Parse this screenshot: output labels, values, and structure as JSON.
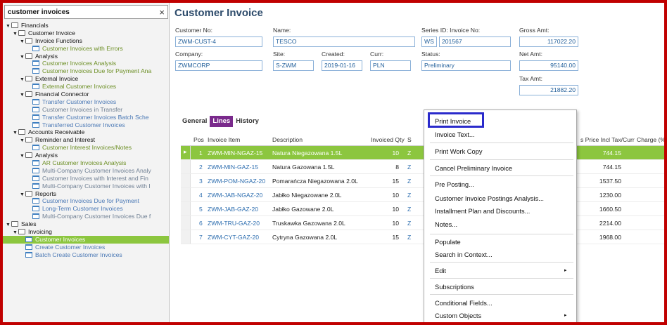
{
  "navigator": {
    "search_value": "customer invoices",
    "close_label": "×",
    "items": [
      {
        "label": "Financials",
        "level": 0,
        "type": "folder",
        "toggle": "▼"
      },
      {
        "label": "Customer Invoice",
        "level": 1,
        "type": "folder",
        "toggle": "▼"
      },
      {
        "label": "Invoice Functions",
        "level": 2,
        "type": "folder",
        "toggle": "▼"
      },
      {
        "label": "Customer Invoices with Errors",
        "level": 3,
        "type": "form",
        "style": "green"
      },
      {
        "label": "Analysis",
        "level": 2,
        "type": "folder",
        "toggle": "▼"
      },
      {
        "label": "Customer Invoices Analysis",
        "level": 3,
        "type": "form",
        "style": "green"
      },
      {
        "label": "Customer Invoices Due for Payment Ana",
        "level": 3,
        "type": "form",
        "style": "green"
      },
      {
        "label": "External Invoice",
        "level": 2,
        "type": "folder",
        "toggle": "▼"
      },
      {
        "label": "External Customer Invoices",
        "level": 3,
        "type": "form",
        "style": "green"
      },
      {
        "label": "Financial Connector",
        "level": 2,
        "type": "folder",
        "toggle": "▼"
      },
      {
        "label": "Transfer Customer Invoices",
        "level": 3,
        "type": "form",
        "style": "blue"
      },
      {
        "label": "Customer Invoices in Transfer",
        "level": 3,
        "type": "form",
        "style": "grey"
      },
      {
        "label": "Transfer Customer Invoices Batch Sche",
        "level": 3,
        "type": "form",
        "style": "blue"
      },
      {
        "label": "Transferred Customer Invoices",
        "level": 3,
        "type": "form",
        "style": "blue"
      },
      {
        "label": "Accounts Receivable",
        "level": 1,
        "type": "folder",
        "toggle": "▼"
      },
      {
        "label": "Reminder and Interest",
        "level": 2,
        "type": "folder",
        "toggle": "▼"
      },
      {
        "label": "Customer Interest Invoices/Notes",
        "level": 3,
        "type": "form",
        "style": "green"
      },
      {
        "label": "Analysis",
        "level": 2,
        "type": "folder",
        "toggle": "▼"
      },
      {
        "label": "AR Customer Invoices Analysis",
        "level": 3,
        "type": "form",
        "style": "green"
      },
      {
        "label": "Multi-Company Customer Invoices Analy",
        "level": 3,
        "type": "form",
        "style": "grey"
      },
      {
        "label": "Customer Invoices with Interest and Fin",
        "level": 3,
        "type": "form",
        "style": "grey"
      },
      {
        "label": "Multi-Company Customer Invoices with I",
        "level": 3,
        "type": "form",
        "style": "grey"
      },
      {
        "label": "Reports",
        "level": 2,
        "type": "folder",
        "toggle": "▼"
      },
      {
        "label": "Customer Invoices Due for Payment",
        "level": 3,
        "type": "form",
        "style": "blue"
      },
      {
        "label": "Long-Term Customer Invoices",
        "level": 3,
        "type": "form",
        "style": "blue"
      },
      {
        "label": "Multi-Company Customer Invoices Due f",
        "level": 3,
        "type": "form",
        "style": "grey"
      },
      {
        "label": "Sales",
        "level": 0,
        "type": "folder",
        "toggle": "▼"
      },
      {
        "label": "Invoicing",
        "level": 1,
        "type": "folder",
        "toggle": "▼"
      },
      {
        "label": "Customer Invoices",
        "level": 2,
        "type": "form",
        "style": "selected"
      },
      {
        "label": "Create Customer Invoices",
        "level": 2,
        "type": "form",
        "style": "blue"
      },
      {
        "label": "Batch Create Customer Invoices",
        "level": 2,
        "type": "form",
        "style": "blue"
      }
    ]
  },
  "header": {
    "title": "Customer Invoice",
    "customer_no_label": "Customer No:",
    "customer_no": "ZWM-CUST-4",
    "name_label": "Name:",
    "name": "TESCO",
    "series_label": "Series ID: Invoice No:",
    "series_id": "WS",
    "invoice_no": "201567",
    "gross_label": "Gross Amt:",
    "gross_amt": "117022.20",
    "company_label": "Company:",
    "company": "ZWMCORP",
    "site_label": "Site:",
    "site": "S-ZWM",
    "created_label": "Created:",
    "created": "2019-01-16",
    "curr_label": "Curr:",
    "curr": "PLN",
    "status_label": "Status:",
    "status": "Preliminary",
    "net_label": "Net Amt:",
    "net_amt": "95140.00",
    "tax_label": "Tax Amt:",
    "tax_amt": "21882.20"
  },
  "tabs": [
    "General",
    "Lines",
    "History"
  ],
  "active_tab": "Lines",
  "grid": {
    "columns": [
      "Pos",
      "Invoice Item",
      "Description",
      "Invoiced Qty",
      "S",
      "s Price Incl Tax/Curr",
      "Charge (%)"
    ],
    "rows": [
      {
        "pos": "1",
        "item": "ZWM-MIN-NGAZ-15",
        "desc": "Natura Niegazowana 1.5L",
        "qty": "10",
        "s": "Z",
        "price": "744.15"
      },
      {
        "pos": "2",
        "item": "ZWM-MIN-GAZ-15",
        "desc": "Natura Gazowana 1.5L",
        "qty": "8",
        "s": "Z",
        "price": "744.15"
      },
      {
        "pos": "3",
        "item": "ZWM-POM-NGAZ-20",
        "desc": "Pomarańcza Niegazowana 2.0L",
        "qty": "15",
        "s": "Z",
        "price": "1537.50"
      },
      {
        "pos": "4",
        "item": "ZWM-JAB-NGAZ-20",
        "desc": "Jabłko Niegazowane 2.0L",
        "qty": "10",
        "s": "Z",
        "price": "1230.00"
      },
      {
        "pos": "5",
        "item": "ZWM-JAB-GAZ-20",
        "desc": "Jabłko Gazowane 2.0L",
        "qty": "10",
        "s": "Z",
        "price": "1660.50"
      },
      {
        "pos": "6",
        "item": "ZWM-TRU-GAZ-20",
        "desc": "Truskawka Gazowana 2.0L",
        "qty": "10",
        "s": "Z",
        "price": "2214.00"
      },
      {
        "pos": "7",
        "item": "ZWM-CYT-GAZ-20",
        "desc": "Cytryna Gazowana 2.0L",
        "qty": "15",
        "s": "Z",
        "price": "1968.00"
      }
    ]
  },
  "context_menu": {
    "items": [
      "Print Invoice",
      "Invoice Text...",
      "Print Work Copy",
      "Cancel Preliminary Invoice",
      "Pre Posting...",
      "Customer Invoice Postings Analysis...",
      "Installment Plan and Discounts...",
      "Notes...",
      "Populate",
      "Search in Context...",
      "Edit",
      "Subscriptions",
      "Conditional Fields...",
      "Custom Objects"
    ],
    "submenu_arrow": "▸"
  }
}
